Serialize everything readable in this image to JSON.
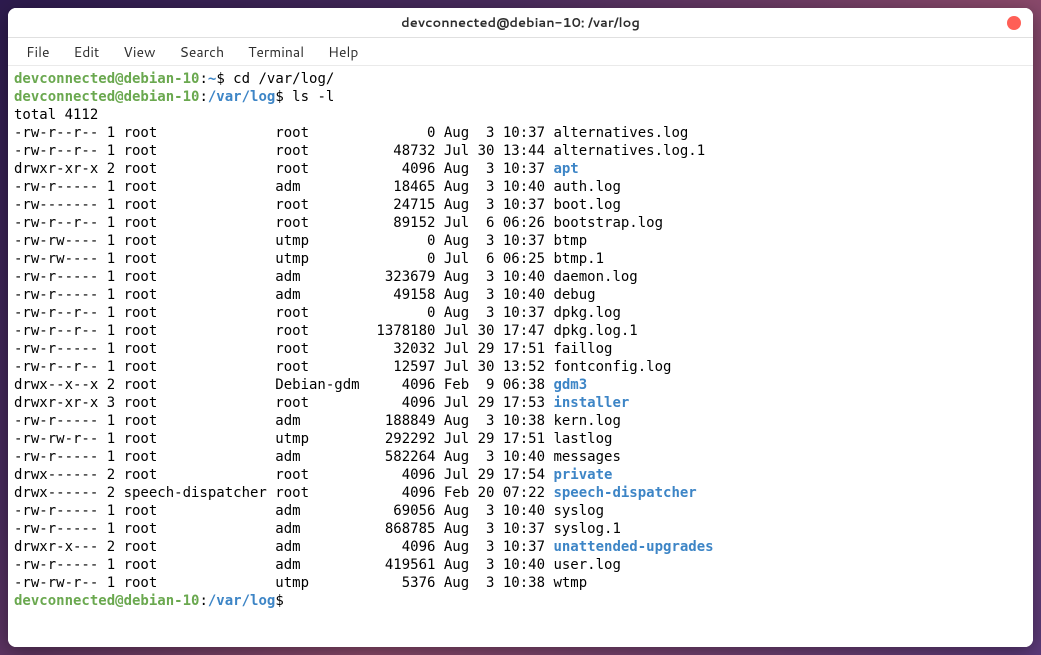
{
  "titlebar": {
    "title": "devconnected@debian-10: /var/log"
  },
  "menu": {
    "file": "File",
    "edit": "Edit",
    "view": "View",
    "search": "Search",
    "terminal": "Terminal",
    "help": "Help"
  },
  "prompt1": {
    "user": "devconnected@debian-10",
    "sep": ":",
    "path": "~",
    "sym": "$ ",
    "cmd": "cd /var/log/"
  },
  "prompt2": {
    "user": "devconnected@debian-10",
    "sep": ":",
    "path": "/var/log",
    "sym": "$ ",
    "cmd": "ls -l"
  },
  "total": "total 4112",
  "rows": [
    {
      "perm": "-rw-r--r--",
      "links": "1",
      "owner": "root",
      "group": "root",
      "size": "0",
      "date": "Aug  3 10:37",
      "name": "alternatives.log",
      "isdir": false
    },
    {
      "perm": "-rw-r--r--",
      "links": "1",
      "owner": "root",
      "group": "root",
      "size": "48732",
      "date": "Jul 30 13:44",
      "name": "alternatives.log.1",
      "isdir": false
    },
    {
      "perm": "drwxr-xr-x",
      "links": "2",
      "owner": "root",
      "group": "root",
      "size": "4096",
      "date": "Aug  3 10:37",
      "name": "apt",
      "isdir": true
    },
    {
      "perm": "-rw-r-----",
      "links": "1",
      "owner": "root",
      "group": "adm",
      "size": "18465",
      "date": "Aug  3 10:40",
      "name": "auth.log",
      "isdir": false
    },
    {
      "perm": "-rw-------",
      "links": "1",
      "owner": "root",
      "group": "root",
      "size": "24715",
      "date": "Aug  3 10:37",
      "name": "boot.log",
      "isdir": false
    },
    {
      "perm": "-rw-r--r--",
      "links": "1",
      "owner": "root",
      "group": "root",
      "size": "89152",
      "date": "Jul  6 06:26",
      "name": "bootstrap.log",
      "isdir": false
    },
    {
      "perm": "-rw-rw----",
      "links": "1",
      "owner": "root",
      "group": "utmp",
      "size": "0",
      "date": "Aug  3 10:37",
      "name": "btmp",
      "isdir": false
    },
    {
      "perm": "-rw-rw----",
      "links": "1",
      "owner": "root",
      "group": "utmp",
      "size": "0",
      "date": "Jul  6 06:25",
      "name": "btmp.1",
      "isdir": false
    },
    {
      "perm": "-rw-r-----",
      "links": "1",
      "owner": "root",
      "group": "adm",
      "size": "323679",
      "date": "Aug  3 10:40",
      "name": "daemon.log",
      "isdir": false
    },
    {
      "perm": "-rw-r-----",
      "links": "1",
      "owner": "root",
      "group": "adm",
      "size": "49158",
      "date": "Aug  3 10:40",
      "name": "debug",
      "isdir": false
    },
    {
      "perm": "-rw-r--r--",
      "links": "1",
      "owner": "root",
      "group": "root",
      "size": "0",
      "date": "Aug  3 10:37",
      "name": "dpkg.log",
      "isdir": false
    },
    {
      "perm": "-rw-r--r--",
      "links": "1",
      "owner": "root",
      "group": "root",
      "size": "1378180",
      "date": "Jul 30 17:47",
      "name": "dpkg.log.1",
      "isdir": false
    },
    {
      "perm": "-rw-r-----",
      "links": "1",
      "owner": "root",
      "group": "root",
      "size": "32032",
      "date": "Jul 29 17:51",
      "name": "faillog",
      "isdir": false
    },
    {
      "perm": "-rw-r--r--",
      "links": "1",
      "owner": "root",
      "group": "root",
      "size": "12597",
      "date": "Jul 30 13:52",
      "name": "fontconfig.log",
      "isdir": false
    },
    {
      "perm": "drwx--x--x",
      "links": "2",
      "owner": "root",
      "group": "Debian-gdm",
      "size": "4096",
      "date": "Feb  9 06:38",
      "name": "gdm3",
      "isdir": true
    },
    {
      "perm": "drwxr-xr-x",
      "links": "3",
      "owner": "root",
      "group": "root",
      "size": "4096",
      "date": "Jul 29 17:53",
      "name": "installer",
      "isdir": true
    },
    {
      "perm": "-rw-r-----",
      "links": "1",
      "owner": "root",
      "group": "adm",
      "size": "188849",
      "date": "Aug  3 10:38",
      "name": "kern.log",
      "isdir": false
    },
    {
      "perm": "-rw-rw-r--",
      "links": "1",
      "owner": "root",
      "group": "utmp",
      "size": "292292",
      "date": "Jul 29 17:51",
      "name": "lastlog",
      "isdir": false
    },
    {
      "perm": "-rw-r-----",
      "links": "1",
      "owner": "root",
      "group": "adm",
      "size": "582264",
      "date": "Aug  3 10:40",
      "name": "messages",
      "isdir": false
    },
    {
      "perm": "drwx------",
      "links": "2",
      "owner": "root",
      "group": "root",
      "size": "4096",
      "date": "Jul 29 17:54",
      "name": "private",
      "isdir": true
    },
    {
      "perm": "drwx------",
      "links": "2",
      "owner": "speech-dispatcher",
      "group": "root",
      "size": "4096",
      "date": "Feb 20 07:22",
      "name": "speech-dispatcher",
      "isdir": true
    },
    {
      "perm": "-rw-r-----",
      "links": "1",
      "owner": "root",
      "group": "adm",
      "size": "69056",
      "date": "Aug  3 10:40",
      "name": "syslog",
      "isdir": false
    },
    {
      "perm": "-rw-r-----",
      "links": "1",
      "owner": "root",
      "group": "adm",
      "size": "868785",
      "date": "Aug  3 10:37",
      "name": "syslog.1",
      "isdir": false
    },
    {
      "perm": "drwxr-x---",
      "links": "2",
      "owner": "root",
      "group": "adm",
      "size": "4096",
      "date": "Aug  3 10:37",
      "name": "unattended-upgrades",
      "isdir": true
    },
    {
      "perm": "-rw-r-----",
      "links": "1",
      "owner": "root",
      "group": "adm",
      "size": "419561",
      "date": "Aug  3 10:40",
      "name": "user.log",
      "isdir": false
    },
    {
      "perm": "-rw-rw-r--",
      "links": "1",
      "owner": "root",
      "group": "utmp",
      "size": "5376",
      "date": "Aug  3 10:38",
      "name": "wtmp",
      "isdir": false
    }
  ],
  "prompt3": {
    "user": "devconnected@debian-10",
    "sep": ":",
    "path": "/var/log",
    "sym": "$ "
  }
}
